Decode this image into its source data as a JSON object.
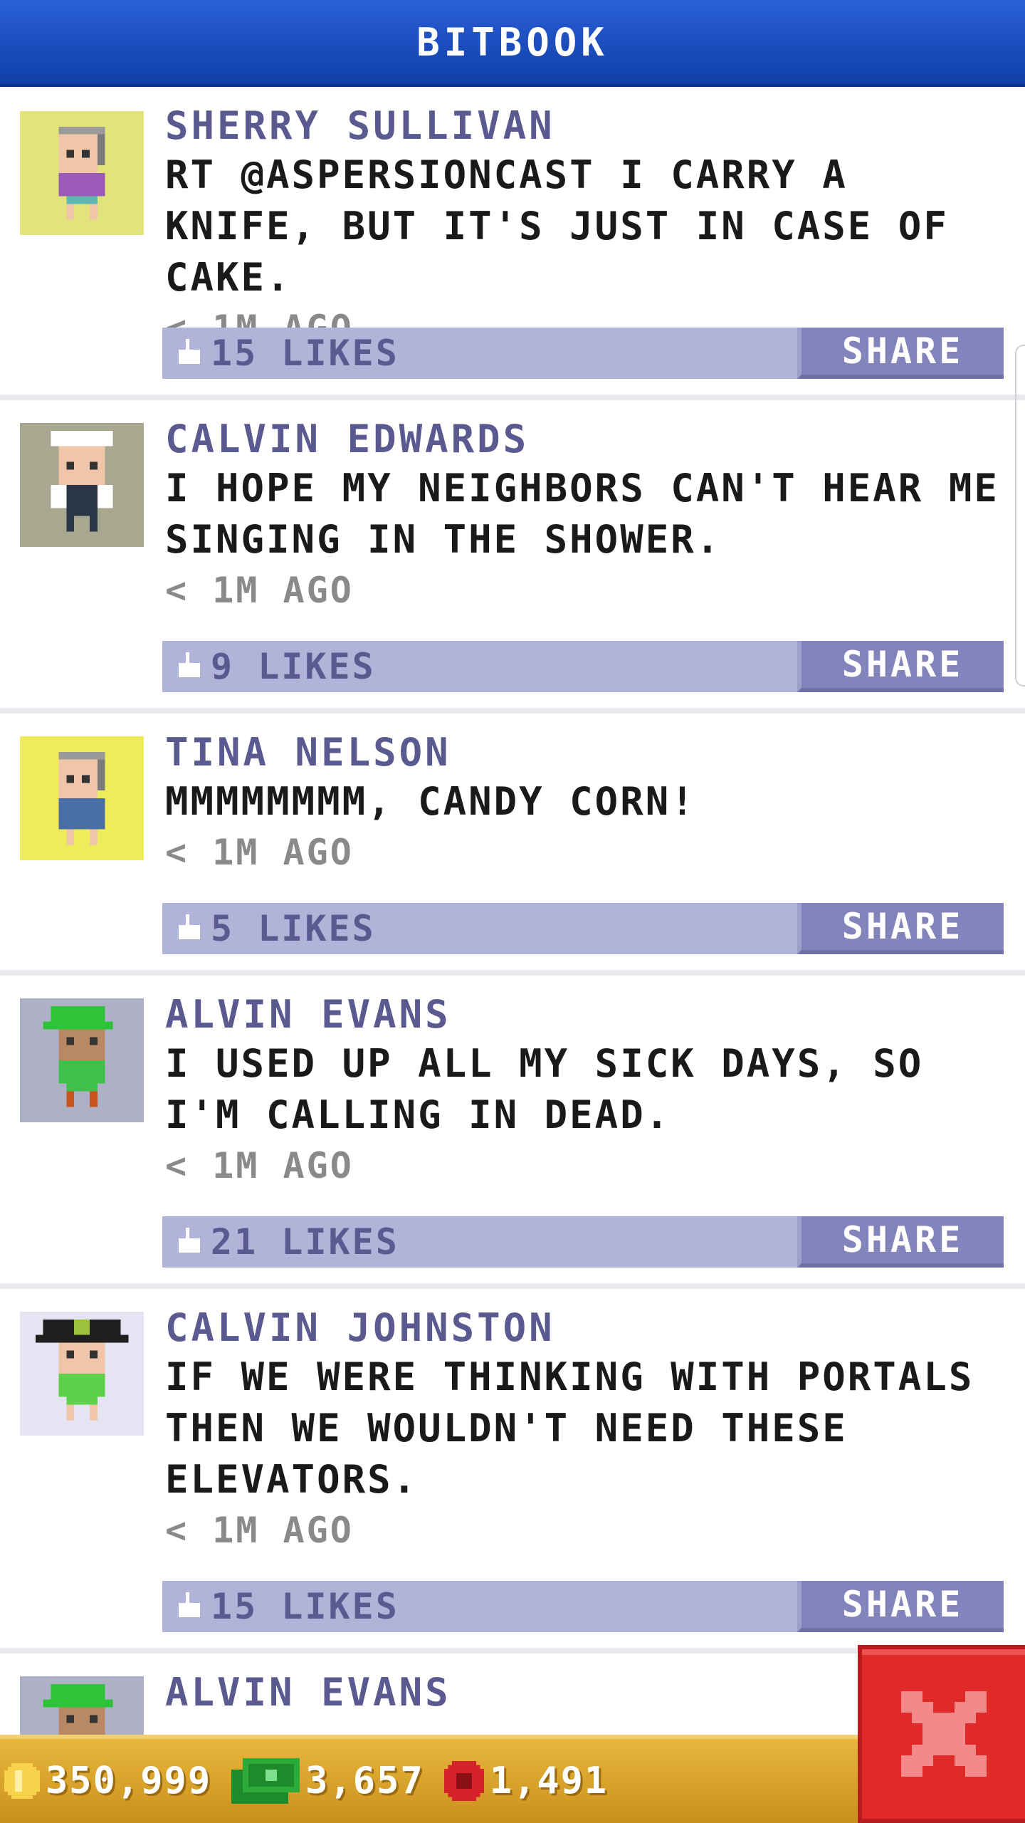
{
  "header": {
    "title": "BITBOOK"
  },
  "posts": [
    {
      "author": "SHERRY SULLIVAN",
      "text": "RT @ASPERSIONCAST I CARRY A KNIFE, BUT IT'S JUST IN CASE OF CAKE.",
      "time": "< 1M AGO",
      "likes": "15 LIKES",
      "share": "SHARE",
      "avatar": {
        "icon": "grandma-avatar-icon",
        "bg": "#e2e37a"
      }
    },
    {
      "author": "CALVIN EDWARDS",
      "text": "I HOPE MY NEIGHBORS CAN'T HEAR ME SINGING IN THE SHOWER.",
      "time": "< 1M AGO",
      "likes": "9 LIKES",
      "share": "SHARE",
      "avatar": {
        "icon": "sailor-avatar-icon",
        "bg": "#a8a890"
      }
    },
    {
      "author": "TINA NELSON",
      "text": "MMMMMMMM, CANDY CORN!",
      "time": "< 1M AGO",
      "likes": "5 LIKES",
      "share": "SHARE",
      "avatar": {
        "icon": "old-woman-avatar-icon",
        "bg": "#eeec5a"
      }
    },
    {
      "author": "ALVIN EVANS",
      "text": "I USED UP ALL MY SICK DAYS, SO I'M CALLING IN DEAD.",
      "time": "< 1M AGO",
      "likes": "21 LIKES",
      "share": "SHARE",
      "avatar": {
        "icon": "green-cap-avatar-icon",
        "bg": "#aeb0c6"
      }
    },
    {
      "author": "CALVIN JOHNSTON",
      "text": "IF WE WERE THINKING WITH PORTALS THEN WE WOULDN'T NEED THESE ELEVATORS.",
      "time": "< 1M AGO",
      "likes": "15 LIKES",
      "share": "SHARE",
      "avatar": {
        "icon": "pirate-avatar-icon",
        "bg": "#e4e4f2"
      }
    },
    {
      "author": "ALVIN EVANS",
      "avatar": {
        "icon": "green-cap-avatar-icon",
        "bg": "#aeb0c6"
      }
    }
  ],
  "status_bar": {
    "coins": "350,999",
    "bux": "3,657",
    "tokens": "1,491"
  },
  "close": {
    "icon": "close-x-icon",
    "color": "#e02a2a"
  }
}
